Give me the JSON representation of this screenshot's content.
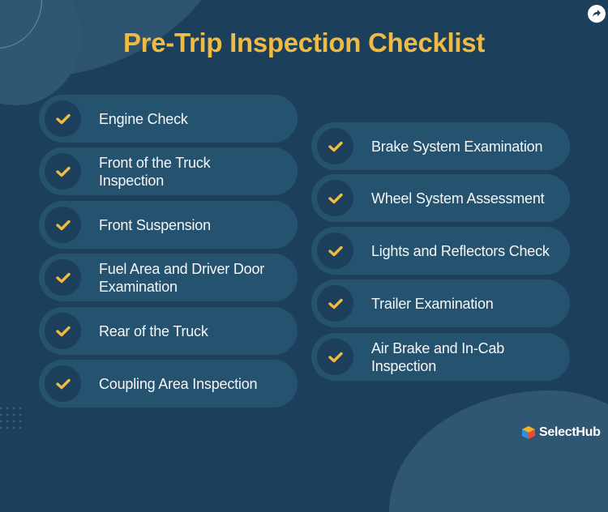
{
  "title": "Pre-Trip Inspection Checklist",
  "colors": {
    "background": "#1c3f5c",
    "pill": "#25536f",
    "accent": "#f0bb42",
    "text": "#f4f6f8"
  },
  "share_icon": "share-arrow-icon",
  "left_items": [
    {
      "label": "Engine Check",
      "icon": "checkmark-icon"
    },
    {
      "label": "Front of the Truck Inspection",
      "icon": "checkmark-icon"
    },
    {
      "label": "Front Suspension",
      "icon": "checkmark-icon"
    },
    {
      "label": "Fuel Area and Driver Door Examination",
      "icon": "checkmark-icon"
    },
    {
      "label": "Rear of the Truck",
      "icon": "checkmark-icon"
    },
    {
      "label": "Coupling Area Inspection",
      "icon": "checkmark-icon"
    }
  ],
  "right_items": [
    {
      "label": "Brake System Examination",
      "icon": "checkmark-icon"
    },
    {
      "label": "Wheel System Assessment",
      "icon": "checkmark-icon"
    },
    {
      "label": "Lights and Reflectors Check",
      "icon": "checkmark-icon"
    },
    {
      "label": "Trailer Examination",
      "icon": "checkmark-icon"
    },
    {
      "label": "Air Brake and In-Cab Inspection",
      "icon": "checkmark-icon"
    }
  ],
  "brand": {
    "name": "SelectHub"
  }
}
